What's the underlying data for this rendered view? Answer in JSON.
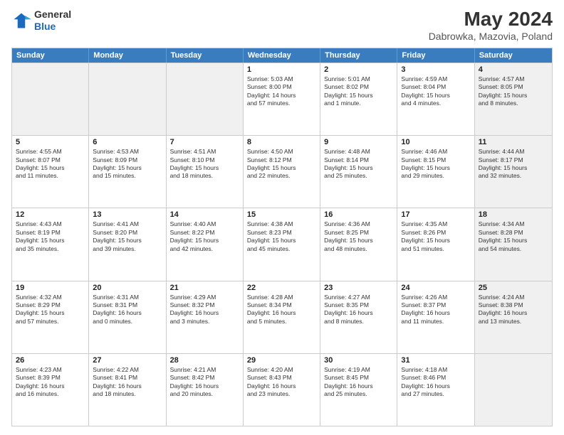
{
  "header": {
    "logo_line1": "General",
    "logo_line2": "Blue",
    "title": "May 2024",
    "location": "Dabrowka, Mazovia, Poland"
  },
  "days_of_week": [
    "Sunday",
    "Monday",
    "Tuesday",
    "Wednesday",
    "Thursday",
    "Friday",
    "Saturday"
  ],
  "weeks": [
    [
      {
        "day": "",
        "info": "",
        "shaded": true
      },
      {
        "day": "",
        "info": "",
        "shaded": true
      },
      {
        "day": "",
        "info": "",
        "shaded": true
      },
      {
        "day": "1",
        "info": "Sunrise: 5:03 AM\nSunset: 8:00 PM\nDaylight: 14 hours\nand 57 minutes."
      },
      {
        "day": "2",
        "info": "Sunrise: 5:01 AM\nSunset: 8:02 PM\nDaylight: 15 hours\nand 1 minute."
      },
      {
        "day": "3",
        "info": "Sunrise: 4:59 AM\nSunset: 8:04 PM\nDaylight: 15 hours\nand 4 minutes."
      },
      {
        "day": "4",
        "info": "Sunrise: 4:57 AM\nSunset: 8:05 PM\nDaylight: 15 hours\nand 8 minutes.",
        "shaded": true
      }
    ],
    [
      {
        "day": "5",
        "info": "Sunrise: 4:55 AM\nSunset: 8:07 PM\nDaylight: 15 hours\nand 11 minutes."
      },
      {
        "day": "6",
        "info": "Sunrise: 4:53 AM\nSunset: 8:09 PM\nDaylight: 15 hours\nand 15 minutes."
      },
      {
        "day": "7",
        "info": "Sunrise: 4:51 AM\nSunset: 8:10 PM\nDaylight: 15 hours\nand 18 minutes."
      },
      {
        "day": "8",
        "info": "Sunrise: 4:50 AM\nSunset: 8:12 PM\nDaylight: 15 hours\nand 22 minutes."
      },
      {
        "day": "9",
        "info": "Sunrise: 4:48 AM\nSunset: 8:14 PM\nDaylight: 15 hours\nand 25 minutes."
      },
      {
        "day": "10",
        "info": "Sunrise: 4:46 AM\nSunset: 8:15 PM\nDaylight: 15 hours\nand 29 minutes."
      },
      {
        "day": "11",
        "info": "Sunrise: 4:44 AM\nSunset: 8:17 PM\nDaylight: 15 hours\nand 32 minutes.",
        "shaded": true
      }
    ],
    [
      {
        "day": "12",
        "info": "Sunrise: 4:43 AM\nSunset: 8:19 PM\nDaylight: 15 hours\nand 35 minutes."
      },
      {
        "day": "13",
        "info": "Sunrise: 4:41 AM\nSunset: 8:20 PM\nDaylight: 15 hours\nand 39 minutes."
      },
      {
        "day": "14",
        "info": "Sunrise: 4:40 AM\nSunset: 8:22 PM\nDaylight: 15 hours\nand 42 minutes."
      },
      {
        "day": "15",
        "info": "Sunrise: 4:38 AM\nSunset: 8:23 PM\nDaylight: 15 hours\nand 45 minutes."
      },
      {
        "day": "16",
        "info": "Sunrise: 4:36 AM\nSunset: 8:25 PM\nDaylight: 15 hours\nand 48 minutes."
      },
      {
        "day": "17",
        "info": "Sunrise: 4:35 AM\nSunset: 8:26 PM\nDaylight: 15 hours\nand 51 minutes."
      },
      {
        "day": "18",
        "info": "Sunrise: 4:34 AM\nSunset: 8:28 PM\nDaylight: 15 hours\nand 54 minutes.",
        "shaded": true
      }
    ],
    [
      {
        "day": "19",
        "info": "Sunrise: 4:32 AM\nSunset: 8:29 PM\nDaylight: 15 hours\nand 57 minutes."
      },
      {
        "day": "20",
        "info": "Sunrise: 4:31 AM\nSunset: 8:31 PM\nDaylight: 16 hours\nand 0 minutes."
      },
      {
        "day": "21",
        "info": "Sunrise: 4:29 AM\nSunset: 8:32 PM\nDaylight: 16 hours\nand 3 minutes."
      },
      {
        "day": "22",
        "info": "Sunrise: 4:28 AM\nSunset: 8:34 PM\nDaylight: 16 hours\nand 5 minutes."
      },
      {
        "day": "23",
        "info": "Sunrise: 4:27 AM\nSunset: 8:35 PM\nDaylight: 16 hours\nand 8 minutes."
      },
      {
        "day": "24",
        "info": "Sunrise: 4:26 AM\nSunset: 8:37 PM\nDaylight: 16 hours\nand 11 minutes."
      },
      {
        "day": "25",
        "info": "Sunrise: 4:24 AM\nSunset: 8:38 PM\nDaylight: 16 hours\nand 13 minutes.",
        "shaded": true
      }
    ],
    [
      {
        "day": "26",
        "info": "Sunrise: 4:23 AM\nSunset: 8:39 PM\nDaylight: 16 hours\nand 16 minutes."
      },
      {
        "day": "27",
        "info": "Sunrise: 4:22 AM\nSunset: 8:41 PM\nDaylight: 16 hours\nand 18 minutes."
      },
      {
        "day": "28",
        "info": "Sunrise: 4:21 AM\nSunset: 8:42 PM\nDaylight: 16 hours\nand 20 minutes."
      },
      {
        "day": "29",
        "info": "Sunrise: 4:20 AM\nSunset: 8:43 PM\nDaylight: 16 hours\nand 23 minutes."
      },
      {
        "day": "30",
        "info": "Sunrise: 4:19 AM\nSunset: 8:45 PM\nDaylight: 16 hours\nand 25 minutes."
      },
      {
        "day": "31",
        "info": "Sunrise: 4:18 AM\nSunset: 8:46 PM\nDaylight: 16 hours\nand 27 minutes."
      },
      {
        "day": "",
        "info": "",
        "shaded": true
      }
    ]
  ]
}
